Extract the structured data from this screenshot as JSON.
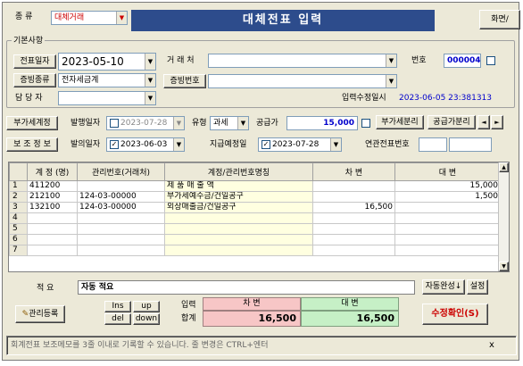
{
  "header": {
    "category_label": "종  류",
    "category_value": "대체거래",
    "title": "대체전표  입력",
    "right_button": "화면/"
  },
  "basic": {
    "group_label": "기본사항",
    "date_label": "전표일자",
    "date_value": "2023-05-10",
    "client_label": "거 래 처",
    "client_value": "",
    "number_label": "번호",
    "number_value": "000004",
    "evidence_type_label": "증빙종류",
    "evidence_type_value": "전자세금계",
    "evidence_no_label": "증빙번호",
    "evidence_no_value": "",
    "manager_label": "담 당 자",
    "manager_value": "",
    "modified_label": "입력수정일시",
    "modified_value": "2023-06-05 23:381313"
  },
  "vat": {
    "label": "부가세계정",
    "issue_date_label": "발행일자",
    "issue_date_value": "2023-07-28",
    "type_label": "유형",
    "type_value": "과세",
    "supply_label": "공급가",
    "supply_value": "15,000",
    "split_button": "부가세분리",
    "supply_split_button": "공급가분리",
    "prev_arrow": "◄",
    "next_arrow": "►"
  },
  "aux": {
    "label": "보 조 정 보",
    "occur_date_label": "발의일자",
    "occur_date_value": "2023-06-03",
    "due_date_label": "지급예정일",
    "due_date_value": "2023-07-28",
    "related_label": "연관전표번호",
    "related_value": ""
  },
  "grid": {
    "headers": [
      "계 정 (명)",
      "관리번호(거래처)",
      "계정/관리번호명칭",
      "차    변",
      "대    변"
    ],
    "rows": [
      {
        "n": "1",
        "account": "411200",
        "mgmt": "",
        "name": "제 품 매 출 액",
        "debit": "",
        "credit": "15,000"
      },
      {
        "n": "2",
        "account": "212100",
        "mgmt": "124-03-00000",
        "name": "부가세예수금/건일공구",
        "debit": "",
        "credit": "1,500"
      },
      {
        "n": "3",
        "account": "132100",
        "mgmt": "124-03-00000",
        "name": "외상매출금/건일공구",
        "debit": "16,500",
        "credit": ""
      },
      {
        "n": "4",
        "account": "",
        "mgmt": "",
        "name": "",
        "debit": "",
        "credit": ""
      },
      {
        "n": "5",
        "account": "",
        "mgmt": "",
        "name": "",
        "debit": "",
        "credit": ""
      },
      {
        "n": "6",
        "account": "",
        "mgmt": "",
        "name": "",
        "debit": "",
        "credit": ""
      },
      {
        "n": "7",
        "account": "",
        "mgmt": "",
        "name": "",
        "debit": "",
        "credit": ""
      }
    ]
  },
  "footer": {
    "memo_label": "적    요",
    "memo_value": "자동 적요",
    "auto_complete_button": "자동완성↓",
    "settings_button": "설정",
    "mgmt_register_button": "관리등록",
    "ins_button": "Ins",
    "up_button": "up",
    "del_button": "del",
    "down_button": "down",
    "input_total_label_1": "입력",
    "input_total_label_2": "합계",
    "debit_header": "차    변",
    "credit_header": "대    변",
    "debit_total": "16,500",
    "credit_total": "16,500",
    "confirm_button": "수정확인(S)",
    "status_text": "회계전표 보조메모를 3줄 이내로 기록할 수 있습니다.  줄 변경은  CTRL+엔터",
    "close_glyph": "x"
  },
  "colors": {
    "title_bg": "#2d4c8c",
    "number_blue": "#0000cc",
    "confirm_red": "#cc0000",
    "debit_pink": "#f7c6c6",
    "credit_green": "#c6f0c6"
  }
}
